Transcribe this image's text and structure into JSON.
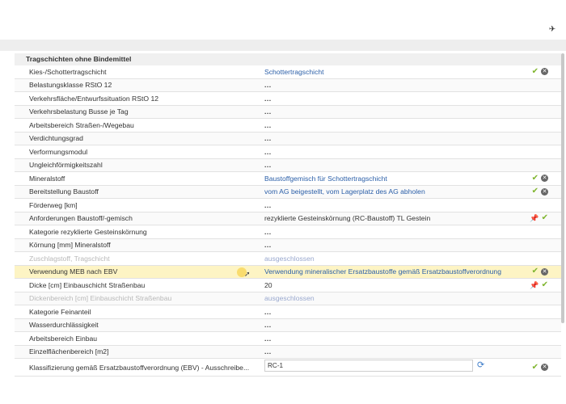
{
  "top_icon": "✈",
  "section": {
    "title": "Tragschichten ohne Bindemittel"
  },
  "rows": [
    {
      "label": "Kies-/Schottertragschicht",
      "value": "Schottertragschicht",
      "kind": "link",
      "actions": [
        "ok",
        "x"
      ]
    },
    {
      "label": "Belastungsklasse RStO 12",
      "value": "...",
      "kind": "dots",
      "actions": []
    },
    {
      "label": "Verkehrsfläche/Entwurfssituation RStO 12",
      "value": "...",
      "kind": "dots",
      "actions": []
    },
    {
      "label": "Verkehrsbelastung Busse je Tag",
      "value": "...",
      "kind": "dots",
      "actions": []
    },
    {
      "label": "Arbeitsbereich Straßen-/Wegebau",
      "value": "...",
      "kind": "dots",
      "actions": []
    },
    {
      "label": "Verdichtungsgrad",
      "value": "...",
      "kind": "dots",
      "actions": []
    },
    {
      "label": "Verformungsmodul",
      "value": "...",
      "kind": "dots",
      "actions": []
    },
    {
      "label": "Ungleichförmigkeitszahl",
      "value": "...",
      "kind": "dots",
      "actions": []
    },
    {
      "label": "Mineralstoff",
      "value": "Baustoffgemisch für Schottertragschicht",
      "kind": "link",
      "actions": [
        "ok",
        "x"
      ]
    },
    {
      "label": "Bereitstellung Baustoff",
      "value": "vom AG beigestellt, vom Lagerplatz des AG abholen",
      "kind": "link",
      "actions": [
        "ok",
        "x"
      ]
    },
    {
      "label": "Förderweg [km]",
      "value": "...",
      "kind": "dots",
      "actions": []
    },
    {
      "label": "Anforderungen Baustoff/-gemisch",
      "value": "rezyklierte Gesteinskörnung (RC-Baustoff) TL Gestein",
      "kind": "text",
      "actions": [
        "pin",
        "ok"
      ]
    },
    {
      "label": "Kategorie rezyklierte Gesteinskörnung",
      "value": "...",
      "kind": "dots",
      "actions": []
    },
    {
      "label": "Körnung [mm] Mineralstoff",
      "value": "...",
      "kind": "dots",
      "actions": []
    },
    {
      "label": "Zuschlagstoff, Tragschicht",
      "value": "ausgeschlossen",
      "kind": "muted",
      "actions": []
    },
    {
      "label": "Verwendung MEB nach EBV",
      "value": "Verwendung mineralischer Ersatzbaustoffe gemäß Ersatzbaustoffverordnung",
      "kind": "link",
      "actions": [
        "ok",
        "x"
      ],
      "highlight": true
    },
    {
      "label": "Dicke [cm] Einbauschicht Straßenbau",
      "value": "20",
      "kind": "text",
      "actions": [
        "pin",
        "ok"
      ]
    },
    {
      "label": "Dickenbereich [cm] Einbauschicht Straßenbau",
      "value": "ausgeschlossen",
      "kind": "muted",
      "actions": []
    },
    {
      "label": "Kategorie Feinanteil",
      "value": "...",
      "kind": "dots",
      "actions": []
    },
    {
      "label": "Wasserdurchlässigkeit",
      "value": "...",
      "kind": "dots",
      "actions": []
    },
    {
      "label": "Arbeitsbereich Einbau",
      "value": "...",
      "kind": "dots",
      "actions": []
    },
    {
      "label": "Einzelflächenbereich [m2]",
      "value": "...",
      "kind": "dots",
      "actions": []
    }
  ],
  "last_row": {
    "label": "Klassifizierung gemäß Ersatzbaustoffverordnung (EBV) - Ausschreibe...",
    "input_value": "RC-1",
    "actions": [
      "ok",
      "x"
    ]
  },
  "icons": {
    "ok": "✔",
    "x": "✕",
    "pin": "📌",
    "refresh": "⟳"
  },
  "colors": {
    "link": "#2b5fa8",
    "ok": "#7fb52e",
    "highlight": "#fdf4c4"
  }
}
